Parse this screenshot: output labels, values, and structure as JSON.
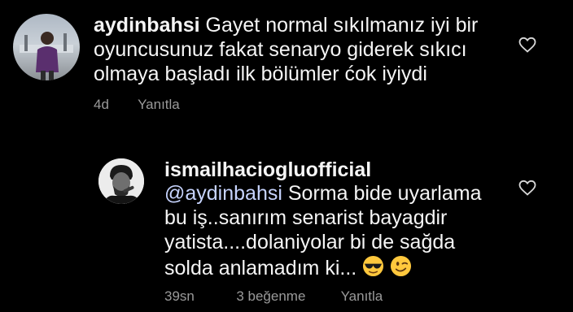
{
  "comments": [
    {
      "username": "aydinbahsi",
      "lines": [
        "Gayet normal sıkılmanız iyi bir",
        "oyuncusunuz fakat senaryo giderek sıkıcı",
        "olmaya başladı ilk bölümler ćok iyiydi"
      ],
      "time": "4d",
      "reply_label": "Yanıtla",
      "like_icon": "heart-outline-icon"
    },
    {
      "username": "ismailhaciogluofficial",
      "mention": "@aydinbahsi",
      "lines": [
        "Sorma bide uyarlama",
        "bu iş..sanırım senarist bayagdir",
        "yatista....dolaniyolar bi de sağda",
        "solda anlamadım ki..."
      ],
      "emojis": [
        "sunglasses-emoji",
        "winking-emoji"
      ],
      "time": "39sn",
      "likes_label": "3 beğenme",
      "reply_label": "Yanıtla",
      "like_icon": "heart-outline-icon"
    }
  ],
  "colors": {
    "background": "#000000",
    "text": "#f5f5f5",
    "meta": "#9a9a9a",
    "mention": "#c7d4ff"
  }
}
